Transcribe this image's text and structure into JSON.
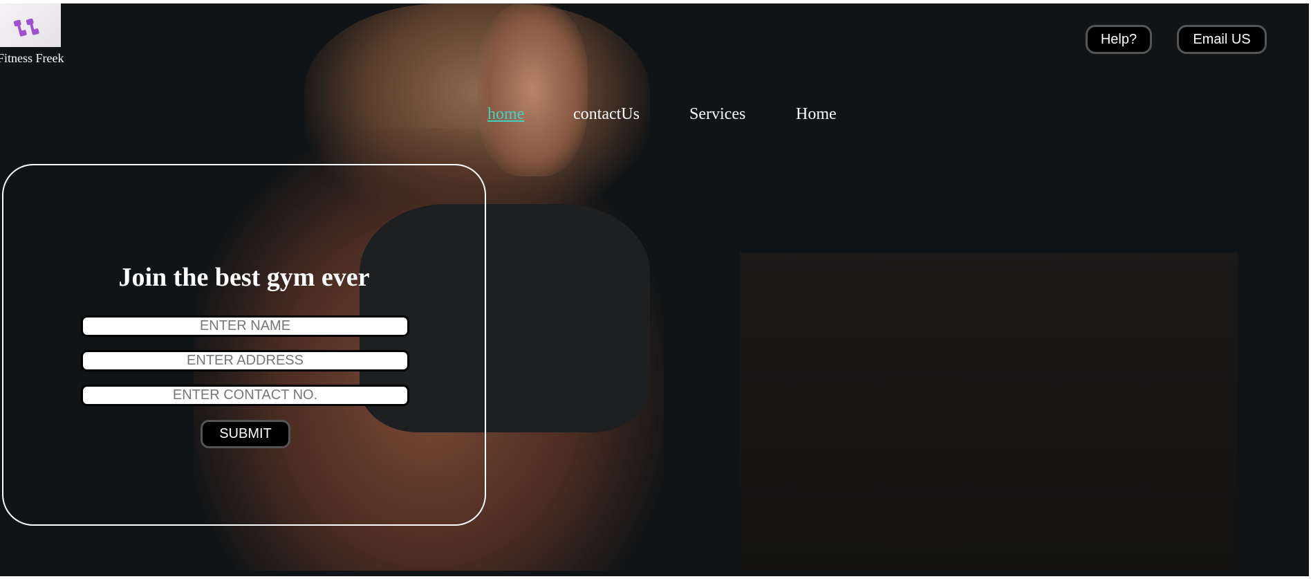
{
  "brand": {
    "name": "Fitness Freek",
    "logo_icon": "dumbbells-icon",
    "accent": "#a04fd0"
  },
  "header": {
    "help_label": "Help?",
    "email_label": "Email US"
  },
  "nav": {
    "items": [
      {
        "label": "home",
        "active": true
      },
      {
        "label": "contactUs"
      },
      {
        "label": "Services"
      },
      {
        "label": "Home"
      }
    ],
    "active_color": "#3fd4c1"
  },
  "form": {
    "title": "Join the best gym ever",
    "name_placeholder": "ENTER NAME",
    "address_placeholder": "ENTER ADDRESS",
    "contact_placeholder": "ENTER CONTACT NO.",
    "submit_label": "SUBMIT"
  }
}
